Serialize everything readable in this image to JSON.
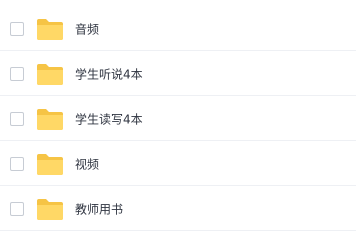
{
  "file_list": {
    "items": [
      {
        "name": "音频",
        "icon": "folder-icon",
        "checked": false
      },
      {
        "name": "学生听说4本",
        "icon": "folder-icon",
        "checked": false
      },
      {
        "name": "学生读写4本",
        "icon": "folder-icon",
        "checked": false
      },
      {
        "name": "视频",
        "icon": "folder-icon",
        "checked": false
      },
      {
        "name": "教师用书",
        "icon": "folder-icon",
        "checked": false
      }
    ]
  },
  "colors": {
    "folder_back": "#f6c445",
    "folder_front": "#ffd866",
    "checkbox_border": "#c7ccd4",
    "separator": "#eef0f4",
    "text": "#2f3440"
  }
}
